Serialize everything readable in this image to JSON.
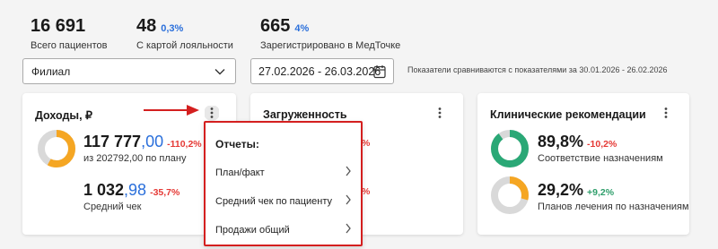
{
  "stats": [
    {
      "value": "16 691",
      "pct": "",
      "label": "Всего пациентов"
    },
    {
      "value": "48",
      "pct": "0,3%",
      "label": "С картой лояльности"
    },
    {
      "value": "665",
      "pct": "4%",
      "label": "Зарегистрировано в МедТочке"
    }
  ],
  "filters": {
    "branch_value": "Филиал",
    "date_range": "27.02.2026 - 26.03.2026",
    "compare_note": "Показатели сравниваются с показателями за 30.01.2026 - 26.02.2026"
  },
  "cards": {
    "income": {
      "title": "Доходы, ₽",
      "revenue": {
        "int": "117 777",
        "dec": ",00",
        "delta": "-110,2%",
        "sub": "из 202792,00 по плану",
        "fill": 0.58
      },
      "avg_check": {
        "int": "1 032",
        "dec": ",98",
        "delta": "-35,7%",
        "sub": "Средний чек"
      }
    },
    "load": {
      "title": "Загруженность",
      "hidden_delta_1": "%",
      "hidden_delta_2": "%"
    },
    "clinical": {
      "title": "Клинические рекомендации",
      "m1": {
        "value": "89,8%",
        "delta": "-10,2%",
        "sub": "Соответствие назначениям",
        "fill": 0.898
      },
      "m2": {
        "value": "29,2%",
        "delta": "+9,2%",
        "sub": "Планов лечения по назначениям",
        "fill": 0.292
      }
    }
  },
  "menu": {
    "title": "Отчеты:",
    "items": [
      {
        "label": "План/факт"
      },
      {
        "label": "Средний чек по пациенту"
      },
      {
        "label": "Продажи общий"
      }
    ]
  },
  "colors": {
    "accent_blue": "#2a6fdb",
    "orange": "#f5a623",
    "green": "#2aa876",
    "red": "#e53935",
    "menu_border": "#d41f1f",
    "track": "#d9d9d9"
  },
  "icons": [
    "chevron-down-icon",
    "calendar-icon",
    "kebab-menu-icon",
    "chevron-right-icon",
    "red-arrow-annotation"
  ]
}
